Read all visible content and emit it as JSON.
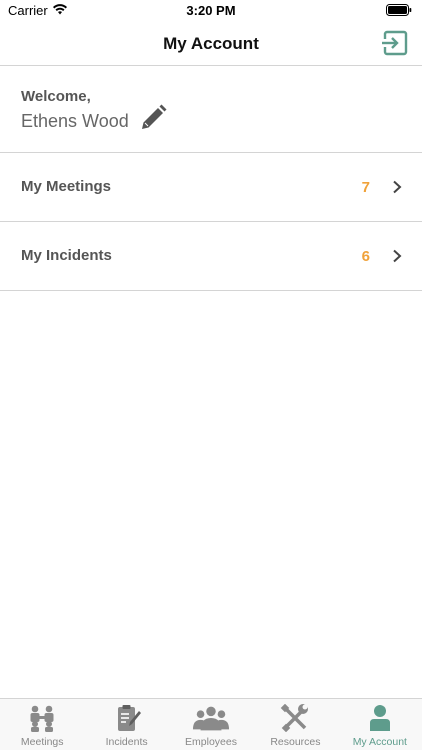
{
  "status_bar": {
    "carrier": "Carrier",
    "time": "3:20 PM"
  },
  "nav": {
    "title": "My Account",
    "logout_icon": "logout-icon"
  },
  "welcome": {
    "label": "Welcome,",
    "name": "Ethens Wood",
    "edit_icon": "pencil-icon"
  },
  "menu": [
    {
      "label": "My Meetings",
      "count": "7"
    },
    {
      "label": "My Incidents",
      "count": "6"
    }
  ],
  "tabs": [
    {
      "label": "Meetings",
      "icon": "meetings-icon",
      "active": false
    },
    {
      "label": "Incidents",
      "icon": "clipboard-icon",
      "active": false
    },
    {
      "label": "Employees",
      "icon": "people-icon",
      "active": false
    },
    {
      "label": "Resources",
      "icon": "tools-icon",
      "active": false
    },
    {
      "label": "My Account",
      "icon": "user-icon",
      "active": true
    }
  ],
  "colors": {
    "accent": "#5e9c8c",
    "count": "#f0a23a",
    "inactive": "#888888"
  }
}
